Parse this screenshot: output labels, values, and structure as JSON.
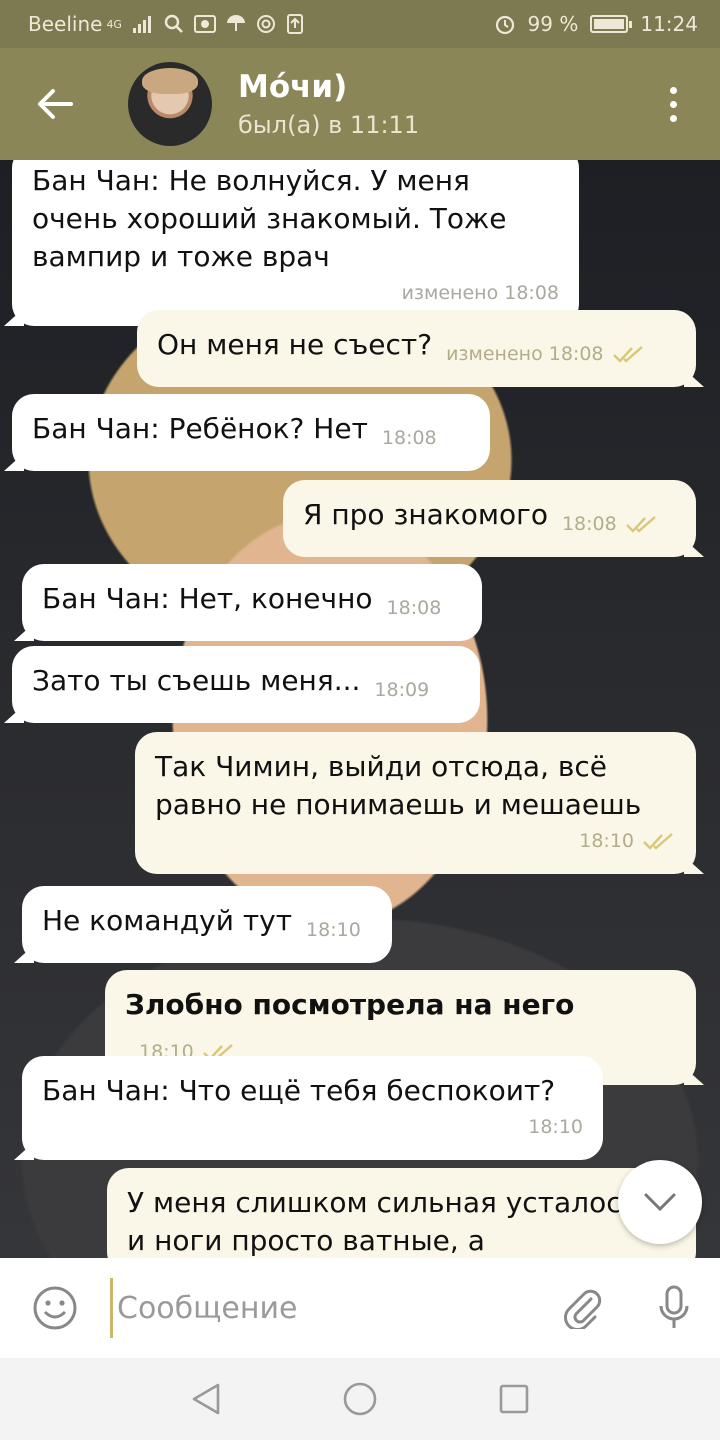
{
  "status_bar": {
    "carrier": "Beeline",
    "network": "4G",
    "battery": "99 %",
    "battery_level": 0.99,
    "time": "11:24"
  },
  "header": {
    "name": "Мо́чи)",
    "status": "был(а) в 11:11"
  },
  "messages": [
    {
      "dir": "in",
      "text": "Бан Чан: Не волнуйся. У меня очень хороший знакомый. Тоже вампир и тоже врач",
      "time": "изменено 18:08"
    },
    {
      "dir": "out",
      "text": "Он меня не съест?",
      "time": "изменено 18:08",
      "read": true
    },
    {
      "dir": "in",
      "text": "Бан Чан: Ребёнок? Нет",
      "time": "18:08"
    },
    {
      "dir": "out",
      "text": "Я про знакомого",
      "time": "18:08",
      "read": true
    },
    {
      "dir": "in",
      "text": "Бан Чан: Нет, конечно",
      "time": "18:08"
    },
    {
      "dir": "in",
      "text": "Зато ты съешь меня...",
      "time": "18:09"
    },
    {
      "dir": "out",
      "text": "Так Чимин, выйди отсюда, всё равно не понимаешь и мешаешь",
      "time": "18:10",
      "read": true
    },
    {
      "dir": "in",
      "text": "Не командуй тут",
      "time": "18:10"
    },
    {
      "dir": "out",
      "text": "Злобно посмотрела на него",
      "time": "18:10",
      "read": true,
      "bold": true
    },
    {
      "dir": "in",
      "text": "Бан Чан: Что ещё тебя беспокоит?",
      "time": "18:10"
    },
    {
      "dir": "out",
      "text": "У меня слишком сильная усталость и ноги просто ватные, а",
      "time": "",
      "read": false
    }
  ],
  "input": {
    "placeholder": "Сообщение"
  },
  "colors": {
    "header": "#8a8658",
    "status_bar": "#7d7a52",
    "incoming_bubble": "#ffffff",
    "outgoing_bubble": "#fbf7e8",
    "read_ticks": "#d8c878"
  },
  "icons": [
    "back-arrow-icon",
    "menu-dots-icon",
    "emoji-icon",
    "attach-icon",
    "mic-icon",
    "chevron-down-icon",
    "nav-back-icon",
    "nav-home-icon",
    "nav-recents-icon"
  ]
}
